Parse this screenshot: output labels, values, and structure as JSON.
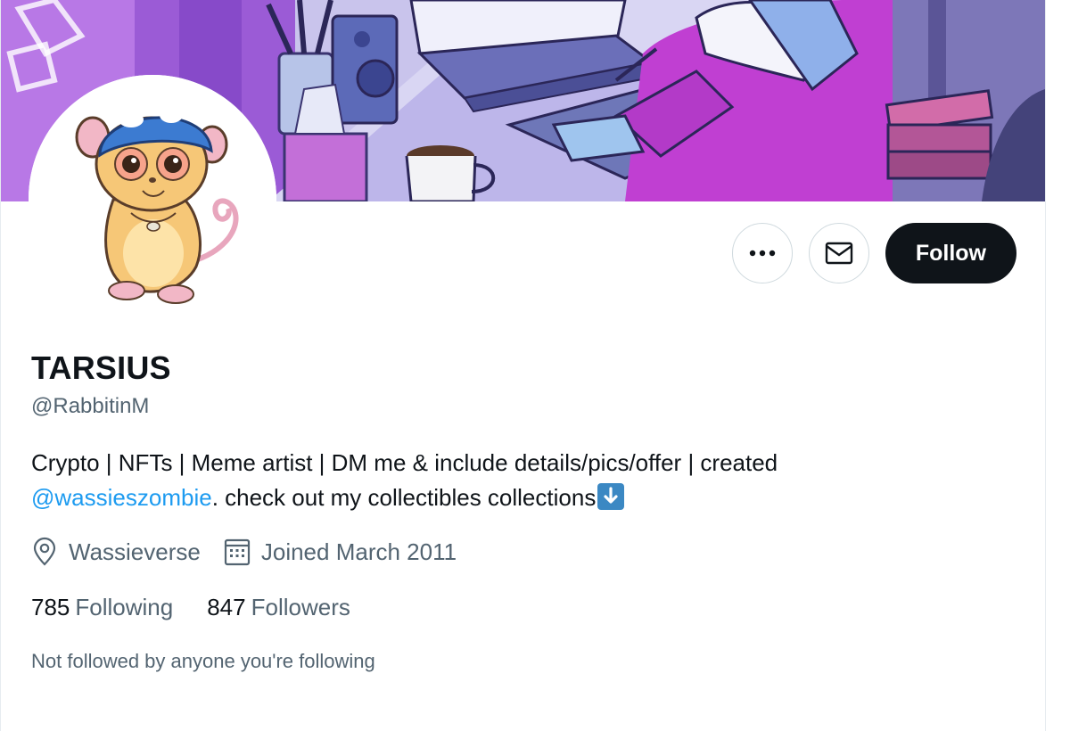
{
  "profile": {
    "display_name": "TARSIUS",
    "handle": "@RabbitinM",
    "bio": {
      "text_before": "Crypto | NFTs | Meme artist | DM me & include details/pics/offer | created",
      "mention": "@wassieszombie",
      "text_after": ". check out my collectibles collections"
    },
    "location": "Wassieverse",
    "joined": "Joined March 2011",
    "following_count": "785",
    "following_label": "Following",
    "followers_count": "847",
    "followers_label": "Followers",
    "not_followed_note": "Not followed by anyone you're following"
  },
  "actions": {
    "more_icon": "more-icon",
    "message_icon": "envelope-icon",
    "follow_label": "Follow"
  },
  "colors": {
    "text_primary": "#0f1419",
    "text_secondary": "#536471",
    "link": "#1d9bf0",
    "follow_bg": "#0f1419",
    "banner_accent": "#b640d6"
  }
}
